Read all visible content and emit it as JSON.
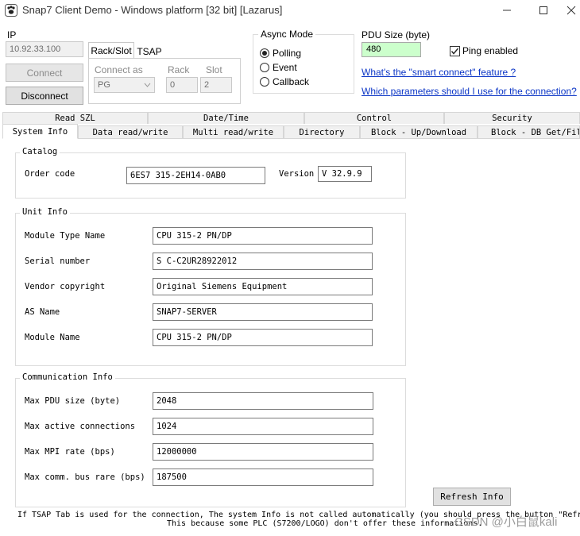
{
  "window": {
    "title": "Snap7 Client Demo - Windows platform [32 bit] [Lazarus]",
    "icons": {
      "app": "paw-icon",
      "minimize": "minimize-icon",
      "maximize": "maximize-icon",
      "close": "close-icon"
    }
  },
  "connection": {
    "ip_label": "IP",
    "ip_value": "10.92.33.100",
    "connect_label": "Connect",
    "disconnect_label": "Disconnect",
    "tabs": [
      "Rack/Slot",
      "TSAP"
    ],
    "connect_as_label": "Connect as",
    "connect_as_value": "PG",
    "rack_label": "Rack",
    "rack_value": "0",
    "slot_label": "Slot",
    "slot_value": "2"
  },
  "async_mode": {
    "title": "Async Mode",
    "options": [
      "Polling",
      "Event",
      "Callback"
    ],
    "selected": "Polling"
  },
  "pdu": {
    "label": "PDU Size (byte)",
    "value": "480",
    "ping_label": "Ping enabled",
    "ping_checked": true,
    "link1": "What's the \"smart connect\" feature ?",
    "link2": "Which parameters should I use for the connection?"
  },
  "tabs_row1": [
    "Read SZL",
    "Date/Time",
    "Control",
    "Security"
  ],
  "tabs_row2": [
    "System Info",
    "Data read/write",
    "Multi read/write",
    "Directory",
    "Block - Up/Download",
    "Block - DB Get/Fill"
  ],
  "catalog": {
    "title": "Catalog",
    "order_code_label": "Order code",
    "order_code": "6ES7 315-2EH14-0AB0",
    "version_label": "Version",
    "version": "V 32.9.9"
  },
  "unit_info": {
    "title": "Unit Info",
    "rows": [
      {
        "label": "Module Type Name",
        "value": "CPU 315-2 PN/DP"
      },
      {
        "label": "Serial number",
        "value": "S C-C2UR28922012"
      },
      {
        "label": "Vendor copyright",
        "value": "Original Siemens Equipment"
      },
      {
        "label": "AS Name",
        "value": "SNAP7-SERVER"
      },
      {
        "label": "Module Name",
        "value": "CPU 315-2 PN/DP"
      }
    ]
  },
  "comm_info": {
    "title": "Communication Info",
    "rows": [
      {
        "label": "Max PDU size (byte)",
        "value": "2048"
      },
      {
        "label": "Max active connections",
        "value": "1024"
      },
      {
        "label": "Max MPI rate (bps)",
        "value": "12000000"
      },
      {
        "label": "Max comm. bus rare (bps)",
        "value": "187500"
      }
    ]
  },
  "refresh_label": "Refresh Info",
  "footer": {
    "line1": "If TSAP Tab is used for the connection, The system Info is not called automatically (you should press the button \"Refr",
    "line2": "This because some PLC (S7200/LOGO) don't offer these informations."
  },
  "watermark": "CSDN @小白鼠kali"
}
